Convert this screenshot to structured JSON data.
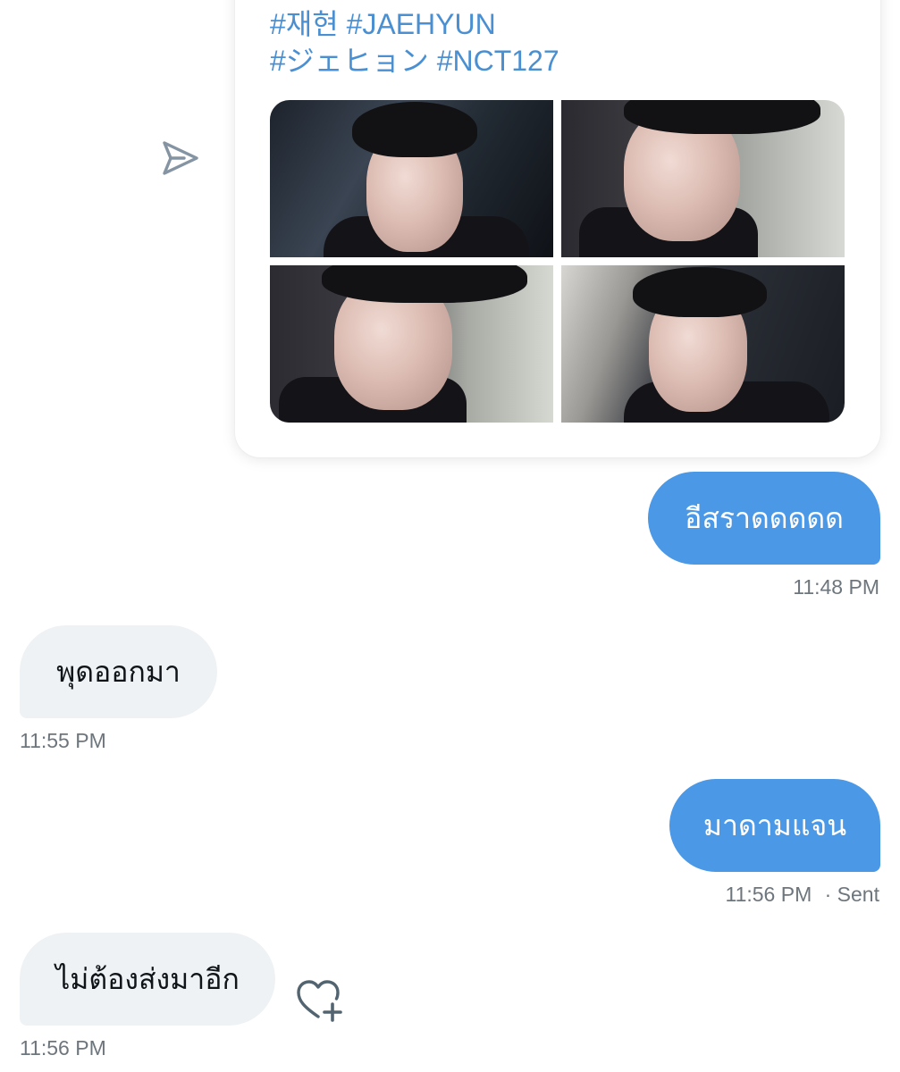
{
  "shared_tweet": {
    "hashtags_line1": "#재현 #JAEHYUN",
    "hashtags_line2": "#ジェヒョン #NCT127",
    "photos": [
      "photo-1",
      "photo-2",
      "photo-3",
      "photo-4"
    ]
  },
  "icons": {
    "share": "share-icon",
    "like_add": "heart-plus-icon"
  },
  "colors": {
    "sent_bubble": "#4a98e6",
    "received_bubble": "#eff2f4",
    "hashtag": "#4a8fd1",
    "timestamp": "#6e767d"
  },
  "messages": [
    {
      "direction": "sent",
      "text": "อีสราดดดดด",
      "time": "11:48 PM",
      "status": ""
    },
    {
      "direction": "received",
      "text": "พุดออกมา",
      "time": "11:55 PM",
      "status": ""
    },
    {
      "direction": "sent",
      "text": "มาดามแจน",
      "time": "11:56 PM",
      "status": "· Sent"
    },
    {
      "direction": "received",
      "text": "ไม่ต้องส่งมาอีก",
      "time": "11:56 PM",
      "status": ""
    }
  ]
}
